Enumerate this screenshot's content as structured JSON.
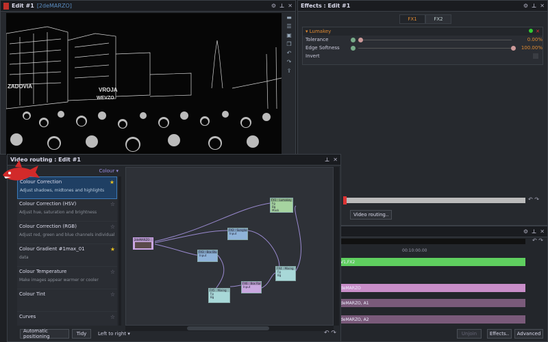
{
  "viewer": {
    "title": "Edit #1",
    "subtitle": "[2deMARZO]",
    "image_text_1": "ZADOVIA",
    "image_text_2": "VROJA",
    "image_text_3": "WEVZO"
  },
  "effects": {
    "title": "Effects : Edit #1",
    "tabs": [
      "FX1",
      "FX2"
    ],
    "effect_name": "Lumakey",
    "params": [
      {
        "label": "Tolerance",
        "value": "0.00%",
        "level": 0.0
      },
      {
        "label": "Edge Softness",
        "value": "100.00%",
        "level": 1.0
      },
      {
        "label": "Invert",
        "value": ""
      }
    ],
    "video_routing_button": "Video routing.."
  },
  "timeline": {
    "timecode": "00:10:00.00",
    "tracks": [
      {
        "label": "V1,FX2",
        "color": "#5fcf5f"
      },
      {
        "label": "deMARZO",
        "color": "#c98ec9"
      },
      {
        "label": "deMARZO, A1",
        "color": "#7a5a7a"
      },
      {
        "label": "deMARZO, A2",
        "color": "#7a5a7a"
      }
    ],
    "buttons": {
      "unjoin": "Unjoin",
      "effects": "Effects..",
      "advanced": "Advanced"
    }
  },
  "routing": {
    "title": "Video routing : Edit #1",
    "category_label": "Category",
    "sort_label": "Colour",
    "categories": [
      {
        "name": "Colour Correction",
        "desc": "Adjust shadows, midtones and highlights",
        "starred": true,
        "selected": true
      },
      {
        "name": "Colour Correction (HSV)",
        "desc": "Adjust hue, saturation and brightness",
        "starred": false,
        "selected": false
      },
      {
        "name": "Colour Correction (RGB)",
        "desc": "Adjust red, green and blue channels individually",
        "starred": false,
        "selected": false
      },
      {
        "name": "Colour Gradient #1max_01",
        "desc": "data",
        "starred": true,
        "selected": false
      },
      {
        "name": "Colour Temperature",
        "desc": "Make images appear warmer or cooler",
        "starred": false,
        "selected": false
      },
      {
        "name": "Colour Tint",
        "desc": "",
        "starred": false,
        "selected": false
      },
      {
        "name": "Curves",
        "desc": "",
        "starred": false,
        "selected": false
      }
    ],
    "nodes": {
      "source": "2deMARZO",
      "lumakey": {
        "title": "FX1 : Lumakey",
        "ports": [
          "Fg",
          "Bg",
          "Mask"
        ]
      },
      "sunglass": {
        "title": "FX2 : Sunglass",
        "ports": [
          "Input"
        ]
      },
      "boxblur": {
        "title": "FX3 : Box Blur",
        "ports": [
          "Input"
        ]
      },
      "mix1": {
        "title": "FX4 : Mixing",
        "ports": [
          "Fg",
          "Bg"
        ]
      },
      "mix2": {
        "title": "FX5 : Mixing",
        "ports": [
          "Fg",
          "Bg"
        ]
      },
      "bluramp": {
        "title": "FX6 : Box Ramp",
        "ports": [
          "Input"
        ]
      }
    },
    "bottom": {
      "auto_pos": "Automatic positioning",
      "tidy": "Tidy",
      "direction": "Left to right"
    }
  },
  "colors": {
    "accent": "#e08a30",
    "selection": "#1f3f63",
    "node_blue": "#8fb3d9",
    "node_green": "#a6d3a0",
    "node_purple": "#c9a8e0",
    "node_teal": "#a8d8d8"
  }
}
